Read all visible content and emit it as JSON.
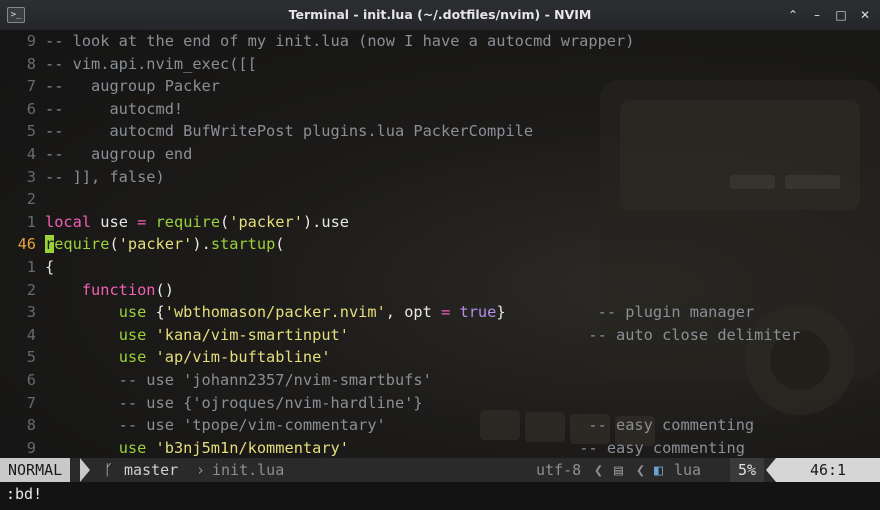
{
  "window": {
    "title": "Terminal - init.lua (~/.dotfiles/nvim) - NVIM",
    "app_icon": "terminal-icon",
    "buttons": [
      "chevron-up-icon",
      "minimize-icon",
      "maximize-icon",
      "close-icon"
    ],
    "button_glyphs": [
      "⌃",
      "–",
      "□",
      "✕"
    ]
  },
  "editor": {
    "lines": [
      {
        "num": "9",
        "parts": [
          [
            "cm",
            "-- look at the end of my init.lua (now I have a autocmd wrapper)"
          ]
        ]
      },
      {
        "num": "8",
        "parts": [
          [
            "cm",
            "-- vim.api.nvim_exec([["
          ]
        ]
      },
      {
        "num": "7",
        "parts": [
          [
            "cm",
            "--   augroup Packer"
          ]
        ]
      },
      {
        "num": "6",
        "parts": [
          [
            "cm",
            "--     autocmd!"
          ]
        ]
      },
      {
        "num": "5",
        "parts": [
          [
            "cm",
            "--     autocmd BufWritePost plugins.lua PackerCompile"
          ]
        ]
      },
      {
        "num": "4",
        "parts": [
          [
            "cm",
            "--   augroup end"
          ]
        ]
      },
      {
        "num": "3",
        "parts": [
          [
            "cm",
            "-- ]], false)"
          ]
        ]
      },
      {
        "num": "2",
        "parts": []
      },
      {
        "num": "1",
        "parts": [
          [
            "kw",
            "local"
          ],
          [
            "tx",
            " use "
          ],
          [
            "op",
            "="
          ],
          [
            "tx",
            " "
          ],
          [
            "fn",
            "require"
          ],
          [
            "tx",
            "("
          ],
          [
            "st",
            "'packer'"
          ],
          [
            "tx",
            ").use"
          ]
        ]
      },
      {
        "num": "46",
        "current": true,
        "parts": [
          [
            "cursor",
            "r"
          ],
          [
            "fn",
            "equire"
          ],
          [
            "tx",
            "("
          ],
          [
            "st",
            "'packer'"
          ],
          [
            "tx",
            ")."
          ],
          [
            "fn",
            "startup"
          ],
          [
            "tx",
            "("
          ]
        ]
      },
      {
        "num": "1",
        "parts": [
          [
            "tx",
            "{"
          ]
        ]
      },
      {
        "num": "2",
        "parts": [
          [
            "tx",
            "    "
          ],
          [
            "kw",
            "function"
          ],
          [
            "tx",
            "()"
          ]
        ]
      },
      {
        "num": "3",
        "parts": [
          [
            "tx",
            "        "
          ],
          [
            "fn",
            "use"
          ],
          [
            "tx",
            " {"
          ],
          [
            "st",
            "'wbthomason/packer.nvim'"
          ],
          [
            "tx",
            ", opt "
          ],
          [
            "op",
            "="
          ],
          [
            "tx",
            " "
          ],
          [
            "bo",
            "true"
          ],
          [
            "tx",
            "}          "
          ],
          [
            "cm",
            "-- plugin manager"
          ]
        ]
      },
      {
        "num": "4",
        "parts": [
          [
            "tx",
            "        "
          ],
          [
            "fn",
            "use"
          ],
          [
            "tx",
            " "
          ],
          [
            "st",
            "'kana/vim-smartinput'"
          ],
          [
            "tx",
            "                          "
          ],
          [
            "cm",
            "-- auto close delimiter"
          ]
        ]
      },
      {
        "num": "5",
        "parts": [
          [
            "tx",
            "        "
          ],
          [
            "fn",
            "use"
          ],
          [
            "tx",
            " "
          ],
          [
            "st",
            "'ap/vim-buftabline'"
          ]
        ]
      },
      {
        "num": "6",
        "parts": [
          [
            "cm",
            "        -- use 'johann2357/nvim-smartbufs'"
          ]
        ]
      },
      {
        "num": "7",
        "parts": [
          [
            "cm",
            "        -- use {'ojroques/nvim-hardline'}"
          ]
        ]
      },
      {
        "num": "8",
        "parts": [
          [
            "cm",
            "        -- use 'tpope/vim-commentary'                      -- easy commenting"
          ]
        ]
      },
      {
        "num": "9",
        "parts": [
          [
            "tx",
            "        "
          ],
          [
            "fn",
            "use"
          ],
          [
            "tx",
            " "
          ],
          [
            "st",
            "'b3nj5m1n/kommentary'"
          ],
          [
            "tx",
            "                         "
          ],
          [
            "cm",
            "-- easy commenting"
          ]
        ]
      }
    ]
  },
  "statusline": {
    "mode": "NORMAL",
    "branch_icon": "git-branch-icon",
    "branch": "master",
    "filename": "init.lua",
    "encoding": "utf-8",
    "fileformat_icon": "file-format-icon",
    "filetype_icon": "lua-file-icon",
    "filetype": "lua",
    "percent": "5%",
    "position": "46:1"
  },
  "cmdline": {
    "text": ":bd!"
  }
}
